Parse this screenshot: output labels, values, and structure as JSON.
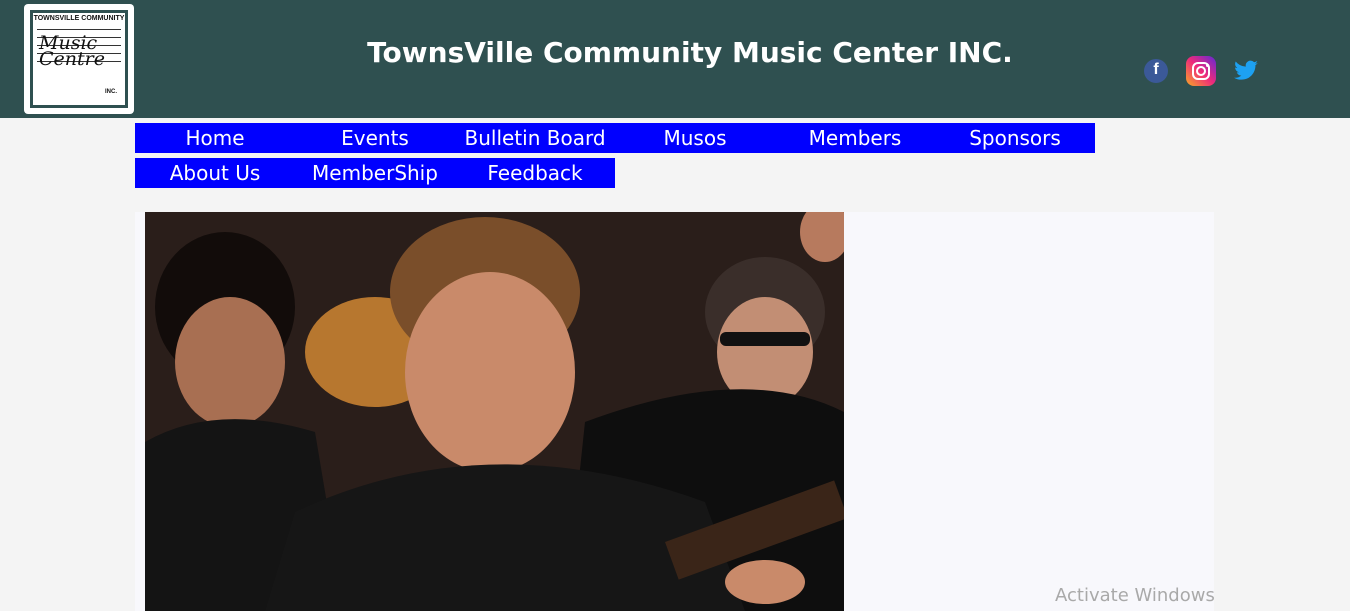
{
  "header": {
    "title": "TownsVille Community Music Center INC.",
    "logo": {
      "top_text": "TOWNSVILLE COMMUNITY",
      "script_text": "Music Centre",
      "inc_text": "INC."
    },
    "social": [
      {
        "name": "facebook-icon",
        "glyph": "f",
        "color": "#3b5998"
      },
      {
        "name": "instagram-icon",
        "color": "#ee2a7b"
      },
      {
        "name": "twitter-icon",
        "color": "#1da1f2"
      }
    ],
    "background": "#2f5050"
  },
  "nav": {
    "row1": [
      "Home",
      "Events",
      "Bulletin Board",
      "Musos",
      "Members",
      "Sponsors"
    ],
    "row2": [
      "About Us",
      "MemberShip",
      "Feedback"
    ],
    "background": "#0000ff"
  },
  "main": {
    "hero_image": "musicians-guitar-photo"
  },
  "overlay": {
    "activate_windows": "Activate Windows"
  }
}
